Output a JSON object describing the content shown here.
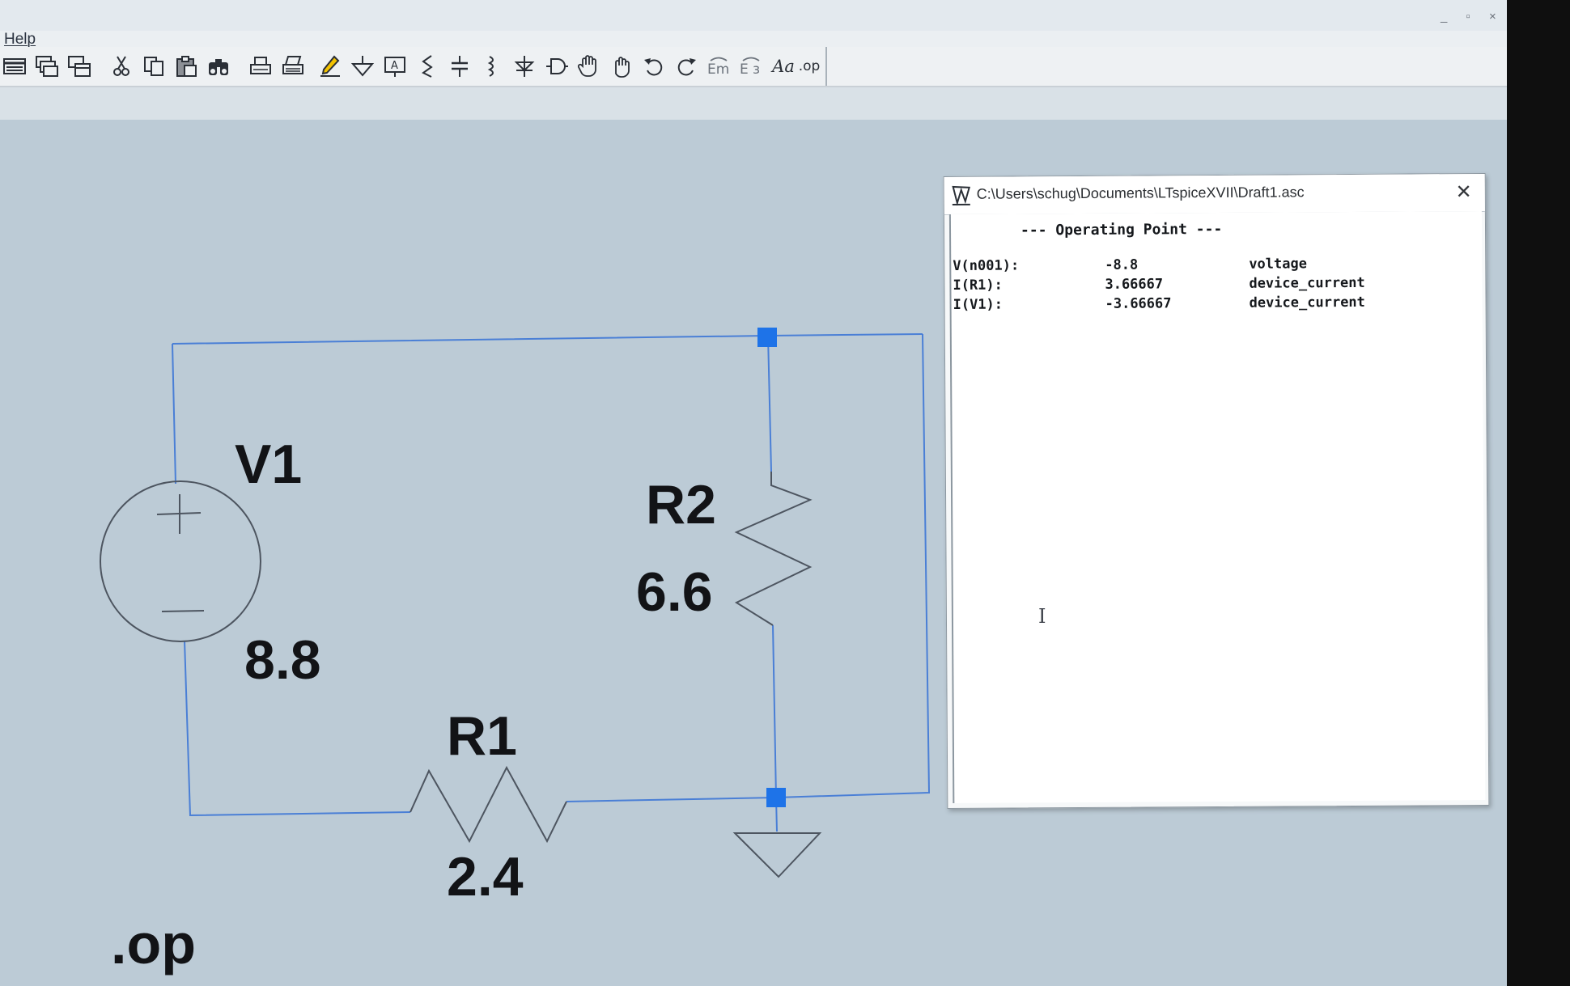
{
  "menu": {
    "items": [
      "Help"
    ]
  },
  "window_controls": {
    "minimize": "_",
    "restore": "▫",
    "close": "×"
  },
  "toolbar": {
    "font_tool_label": "Aa",
    "op_tool_label": ".op"
  },
  "schematic": {
    "components": {
      "v1": {
        "name": "V1",
        "value": "8.8"
      },
      "r1": {
        "name": "R1",
        "value": "2.4"
      },
      "r2": {
        "name": "R2",
        "value": "6.6"
      }
    },
    "directive": ".op"
  },
  "op_dialog": {
    "title": "C:\\Users\\schug\\Documents\\LTspiceXVII\\Draft1.asc",
    "header": "--- Operating Point ---",
    "close_label": "✕",
    "rows": [
      {
        "name": "V(n001):",
        "value": "-8.8",
        "type": "voltage"
      },
      {
        "name": "I(R1):",
        "value": "3.66667",
        "type": "device_current"
      },
      {
        "name": "I(V1):",
        "value": "-3.66667",
        "type": "device_current"
      }
    ]
  },
  "colors": {
    "wire": "#4a7fd6",
    "junction": "#1e73e8",
    "symbol": "#4d5560",
    "canvas": "#bccbd6"
  }
}
